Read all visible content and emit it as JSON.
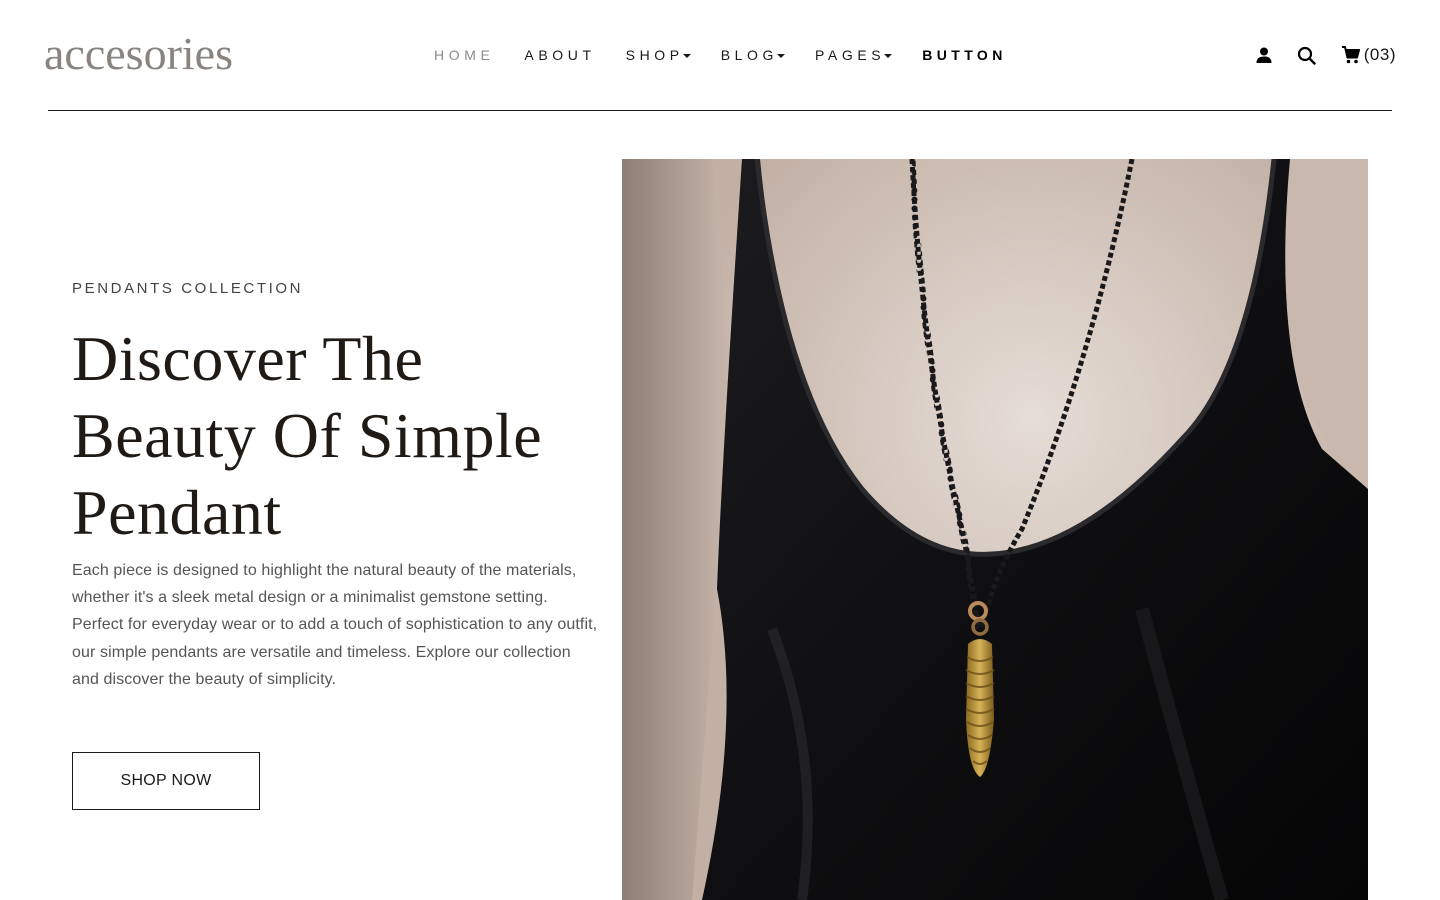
{
  "brand": {
    "logo_text": "accesories"
  },
  "nav": {
    "items": [
      {
        "label": "HOME",
        "has_dropdown": false
      },
      {
        "label": "ABOUT",
        "has_dropdown": false
      },
      {
        "label": "SHOP",
        "has_dropdown": true
      },
      {
        "label": "BLOG",
        "has_dropdown": true
      },
      {
        "label": "PAGES",
        "has_dropdown": true
      },
      {
        "label": "BUTTON",
        "has_dropdown": false
      }
    ]
  },
  "actions": {
    "user_icon": "user-icon",
    "search_icon": "search-icon",
    "cart_icon": "cart-icon",
    "cart_count": "(03)"
  },
  "hero": {
    "eyebrow": "PENDANTS COLLECTION",
    "headline_line1": "Discover The",
    "headline_line2": "Beauty Of Simple",
    "headline_line3": "Pendant",
    "description": "Each piece is designed to highlight the natural beauty of the materials, whether it's a sleek metal design or a minimalist gemstone setting. Perfect for everyday wear or to add a touch of sophistication to any outfit, our simple pendants are versatile and timeless. Explore our collection and discover the beauty of simplicity.",
    "cta_label": "SHOP NOW"
  },
  "colors": {
    "text_dark": "#1f1a15",
    "muted": "#8c8c8c",
    "body_text": "#555555",
    "accent_gold": "#c9a446"
  }
}
